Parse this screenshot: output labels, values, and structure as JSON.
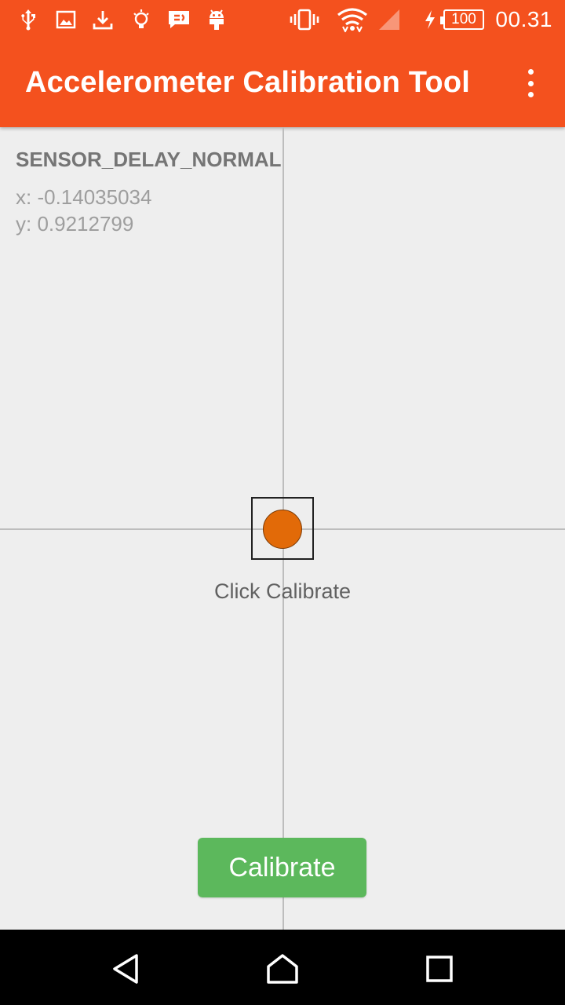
{
  "statusbar": {
    "icons": [
      "usb-icon",
      "image-icon",
      "download-icon",
      "bulb-icon",
      "message-icon",
      "android-icon",
      "vibrate-icon",
      "wifi-icon",
      "signal-icon",
      "charging-icon"
    ],
    "battery": "100",
    "time": "00.31"
  },
  "appbar": {
    "title": "Accelerometer Calibration Tool",
    "menu_icon": "more-vert-icon"
  },
  "sensor": {
    "delay_mode": "SENSOR_DELAY_NORMAL",
    "x_text": "x: -0.14035034",
    "y_text": "y: 0.9212799"
  },
  "calibration": {
    "hint": "Click Calibrate",
    "button_label": "Calibrate",
    "dot_color": "#e26a08",
    "button_color": "#5cb85c"
  },
  "colors": {
    "app_bar": "#f4511e",
    "background": "#eeeeee"
  },
  "navbar": {
    "icons": [
      "back-icon",
      "home-icon",
      "recents-icon"
    ]
  }
}
